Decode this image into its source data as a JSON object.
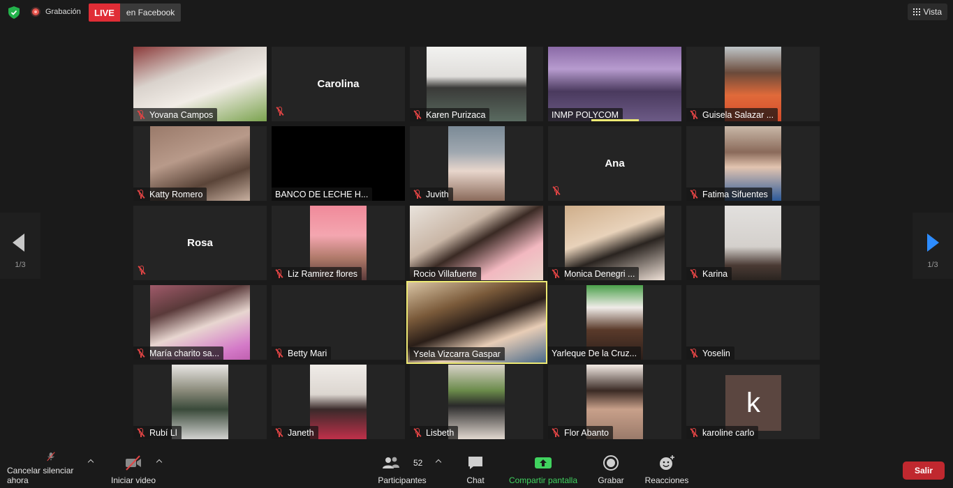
{
  "topbar": {
    "recording_label": "Grabación",
    "live_badge": "LIVE",
    "live_destination": "en Facebook",
    "view_label": "Vista"
  },
  "pagination": {
    "left": "1/3",
    "right": "1/3"
  },
  "participants": [
    {
      "name": "Yovana Campos",
      "muted": true,
      "video": true
    },
    {
      "name": "Carolina",
      "muted": true,
      "video": false
    },
    {
      "name": "Karen Purizaca",
      "muted": true,
      "video": true
    },
    {
      "name": "INMP POLYCOM",
      "muted": false,
      "video": true
    },
    {
      "name": "Guisela Salazar ...",
      "muted": true,
      "video": true
    },
    {
      "name": "Katty Romero",
      "muted": true,
      "video": true
    },
    {
      "name": "BANCO DE LECHE H...",
      "muted": false,
      "video": true
    },
    {
      "name": "Juvith",
      "muted": true,
      "video": true
    },
    {
      "name": "Ana",
      "muted": true,
      "video": false
    },
    {
      "name": "Fatima Sifuentes",
      "muted": true,
      "video": true
    },
    {
      "name": "Rosa",
      "muted": true,
      "video": false
    },
    {
      "name": "Liz Ramirez flores",
      "muted": true,
      "video": true
    },
    {
      "name": "Rocio Villafuerte",
      "muted": false,
      "video": true
    },
    {
      "name": "Monica Denegri ...",
      "muted": true,
      "video": true
    },
    {
      "name": "Karina",
      "muted": true,
      "video": true
    },
    {
      "name": "María charito sa...",
      "muted": true,
      "video": true
    },
    {
      "name": "Betty Mari",
      "muted": true,
      "video": false
    },
    {
      "name": "Ysela Vizcarra Gaspar",
      "muted": false,
      "video": true,
      "active_speaker": true
    },
    {
      "name": "Yarleque De la Cruz...",
      "muted": false,
      "video": true
    },
    {
      "name": "Yoselin",
      "muted": true,
      "video": false
    },
    {
      "name": "Rubí Ll",
      "muted": true,
      "video": true
    },
    {
      "name": "Janeth",
      "muted": true,
      "video": true
    },
    {
      "name": "Lisbeth",
      "muted": true,
      "video": true
    },
    {
      "name": "Flor Abanto",
      "muted": true,
      "video": true
    },
    {
      "name": "karoline carlo",
      "muted": true,
      "video": false,
      "avatar_letter": "k"
    }
  ],
  "toolbar": {
    "mute_label": "Cancelar silenciar ahora",
    "video_label": "Iniciar video",
    "participants_label": "Participantes",
    "participants_count": "52",
    "chat_label": "Chat",
    "share_label": "Compartir pantalla",
    "record_label": "Grabar",
    "reactions_label": "Reacciones",
    "leave_label": "Salir"
  },
  "colors": {
    "accent_blue": "#2d8cff",
    "share_green": "#40d35f",
    "live_red": "#e02d36",
    "leave_red": "#c0282f",
    "speaker_highlight": "#eeea74",
    "muted_red": "#e04444"
  }
}
